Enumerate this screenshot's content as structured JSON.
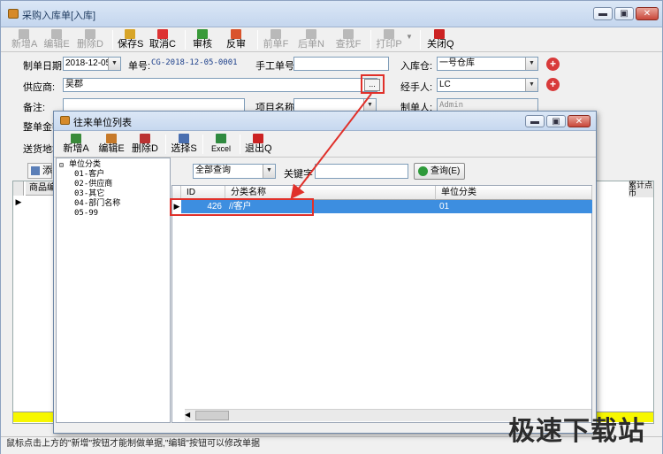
{
  "window": {
    "title": "采购入库单[入库]",
    "controls": {
      "minimize": "▬",
      "maximize": "▣",
      "close": "✕"
    }
  },
  "toolbar": {
    "items": [
      {
        "label": "新增A",
        "icon": "plus-icon",
        "disabled": true
      },
      {
        "label": "编辑E",
        "icon": "edit-icon",
        "disabled": true
      },
      {
        "label": "删除D",
        "icon": "delete-icon",
        "disabled": true
      },
      {
        "label": "保存S",
        "icon": "save-icon",
        "disabled": false
      },
      {
        "label": "取消C",
        "icon": "cancel-icon",
        "disabled": false
      },
      {
        "label": "审核",
        "icon": "check-icon",
        "disabled": false
      },
      {
        "label": "反审",
        "icon": "unapprove-icon",
        "disabled": false
      },
      {
        "label": "前单F",
        "icon": "prev-icon",
        "disabled": true
      },
      {
        "label": "后单N",
        "icon": "next-icon",
        "disabled": true
      },
      {
        "label": "查找F",
        "icon": "binoculars-icon",
        "disabled": true
      },
      {
        "label": "打印P",
        "icon": "print-icon",
        "disabled": true
      },
      {
        "label": "关闭Q",
        "icon": "close-icon",
        "disabled": false
      }
    ]
  },
  "form": {
    "date_label": "制单日期:",
    "date_value": "2018-12-05",
    "docno_label": "单号:",
    "docno_value": "CG-2018-12-05-0001",
    "manual_no_label": "手工单号:",
    "manual_no_value": "",
    "warehouse_label": "入库仓:",
    "warehouse_value": "一号仓库",
    "supplier_label": "供应商:",
    "supplier_value": "吴郡",
    "ellipsis": "...",
    "handler_label": "经手人:",
    "handler_value": "LC",
    "remark_label": "备注:",
    "project_label": "项目名称:",
    "maker_label": "制单人:",
    "maker_value": "Admin",
    "discount_label": "整单金额",
    "address_label": "送货地址",
    "grid_col1": "商品编",
    "grid_col_right": "累计点币",
    "add_btn": "添"
  },
  "dialog": {
    "title": "往来单位列表",
    "toolbar": [
      {
        "label": "新增A",
        "icon": "plus-icon"
      },
      {
        "label": "编辑E",
        "icon": "edit-icon"
      },
      {
        "label": "删除D",
        "icon": "delete-icon"
      },
      {
        "label": "选择S",
        "icon": "select-icon"
      },
      {
        "label": "Excel",
        "icon": "excel-icon"
      },
      {
        "label": "退出Q",
        "icon": "exit-icon"
      }
    ],
    "tree": {
      "root": "单位分类",
      "children": [
        "01-客户",
        "02-供应商",
        "03-其它",
        "04-部门名称",
        "05-99"
      ]
    },
    "filter_value": "全部查询",
    "keyword_label": "关键字",
    "keyword_value": "",
    "query_btn": "查询(E)",
    "grid": {
      "columns": [
        "ID",
        "分类名称",
        "单位分类"
      ],
      "rows": [
        {
          "id": "426",
          "name": "//客户",
          "category": "01"
        }
      ]
    }
  },
  "status_text": "鼠标点击上方的\"新增\"按钮才能制做单据,\"编辑\"按钮可以修改单据",
  "watermark": "极速下载站",
  "colors": {
    "accent": "#3d8ee0",
    "highlight": "#e0302a",
    "yellow_row": "#f7f700"
  }
}
